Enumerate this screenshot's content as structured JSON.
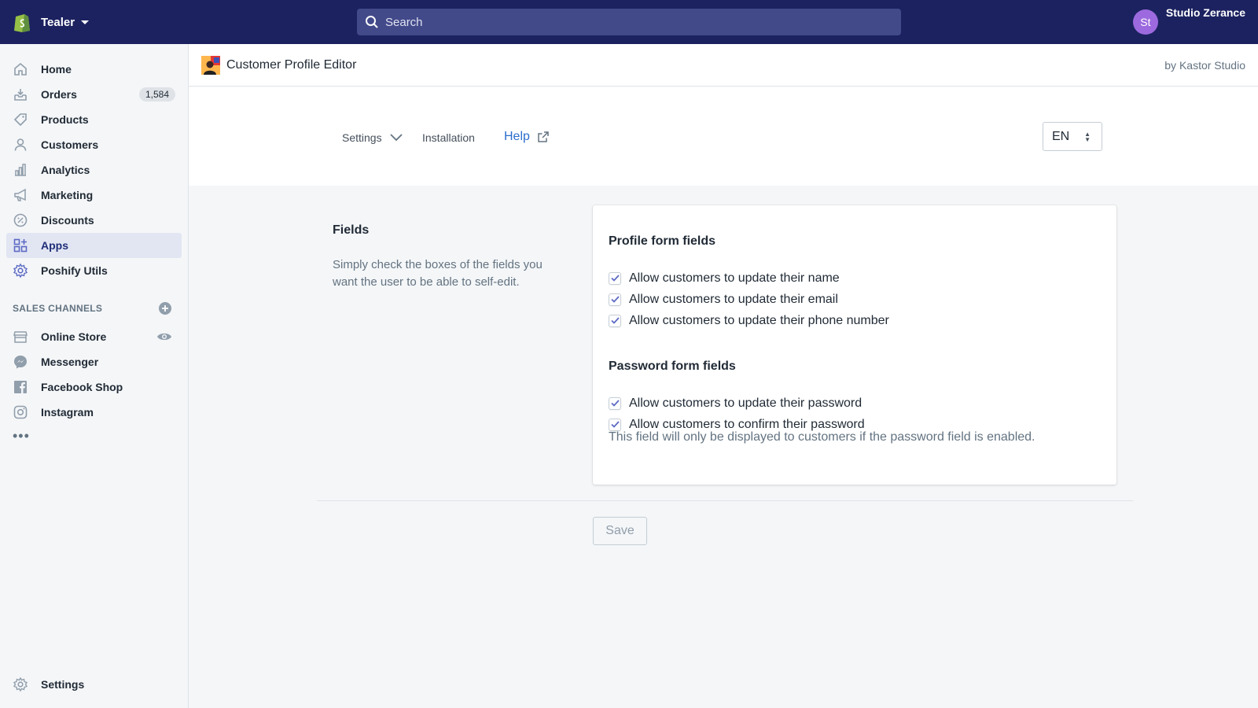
{
  "topbar": {
    "store_name": "Tealer",
    "search_placeholder": "Search",
    "avatar_initials": "St",
    "account_name": "Studio Zerance",
    "bg_color": "#1c2260"
  },
  "sidebar": {
    "items": [
      {
        "label": "Home"
      },
      {
        "label": "Orders",
        "badge": "1,584"
      },
      {
        "label": "Products"
      },
      {
        "label": "Customers"
      },
      {
        "label": "Analytics"
      },
      {
        "label": "Marketing"
      },
      {
        "label": "Discounts"
      },
      {
        "label": "Apps",
        "active": true
      },
      {
        "label": "Poshify Utils"
      }
    ],
    "sales_channels_heading": "SALES CHANNELS",
    "channels": [
      {
        "label": "Online Store"
      },
      {
        "label": "Messenger"
      },
      {
        "label": "Facebook Shop"
      },
      {
        "label": "Instagram"
      }
    ],
    "more": "•••",
    "settings_label": "Settings"
  },
  "app": {
    "title": "Customer Profile Editor",
    "byline": "by Kastor Studio",
    "tabs": {
      "settings": "Settings",
      "installation": "Installation",
      "help": "Help"
    },
    "language": "EN"
  },
  "fields_section": {
    "title": "Fields",
    "description": "Simply check the boxes of the fields you want the user to be able to self-edit.",
    "profile_heading": "Profile form fields",
    "profile_options": [
      {
        "label": "Allow customers to update their name",
        "checked": true
      },
      {
        "label": "Allow customers to update their email",
        "checked": true
      },
      {
        "label": "Allow customers to update their phone number",
        "checked": true
      }
    ],
    "password_heading": "Password form fields",
    "password_options": [
      {
        "label": "Allow customers to update their password",
        "checked": true
      },
      {
        "label": "Allow customers to confirm their password",
        "checked": true
      }
    ],
    "password_help": "This field will only be displayed to customers if the password field is enabled."
  },
  "save_label": "Save",
  "accent_color": "#5c6ac4"
}
